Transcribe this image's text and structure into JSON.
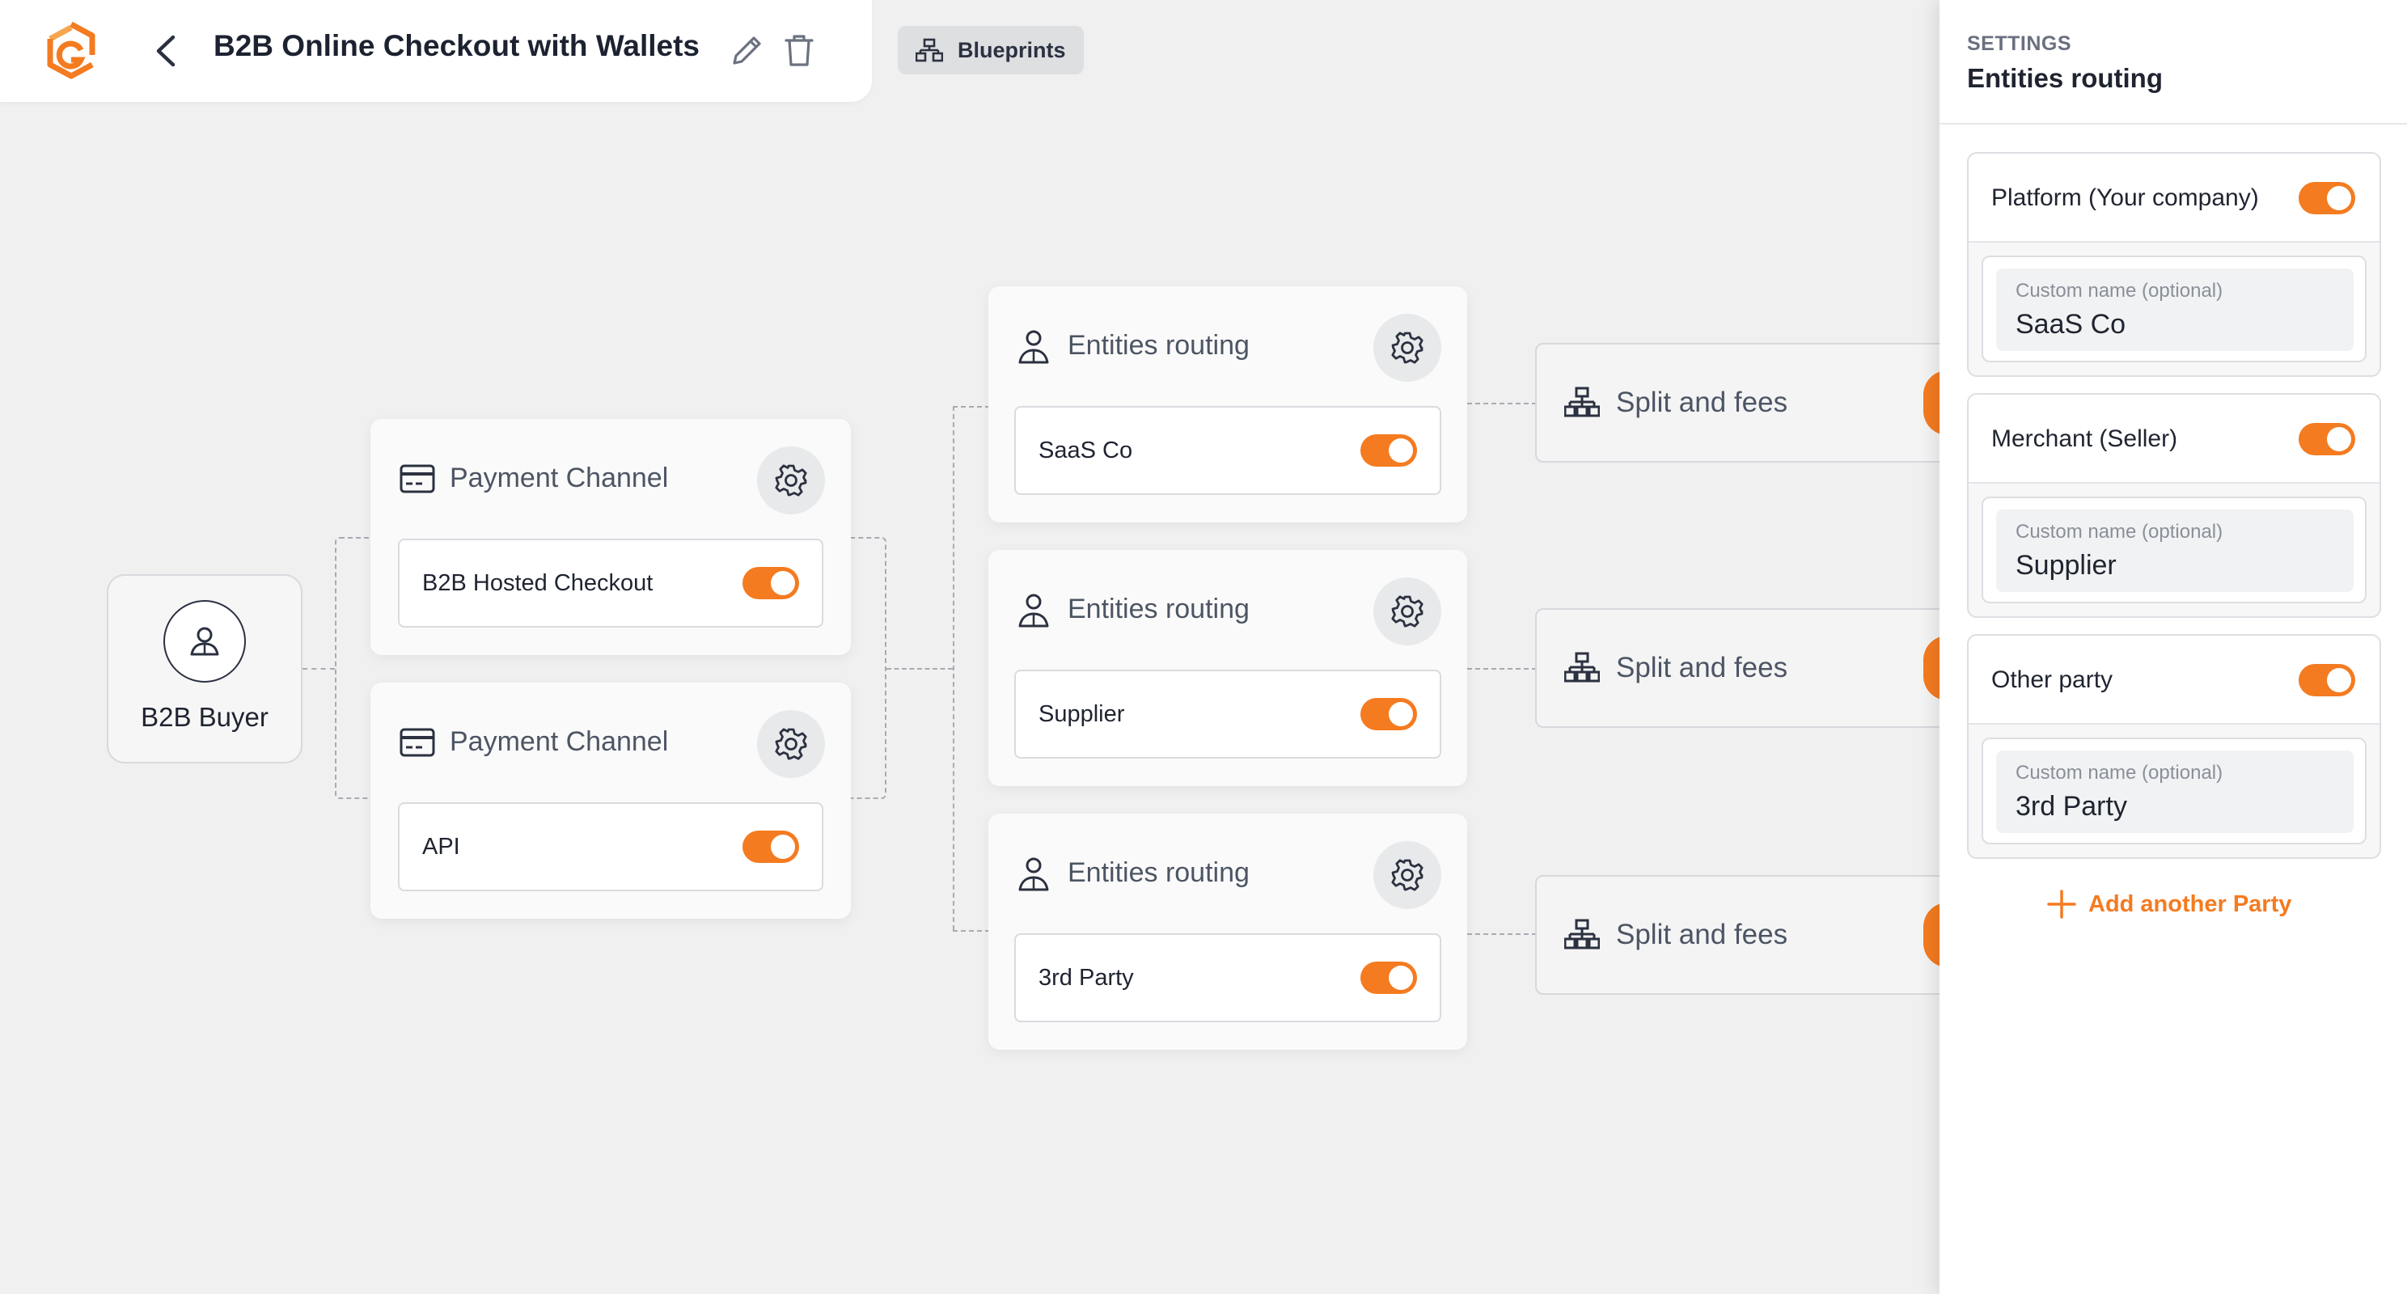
{
  "header": {
    "title": "B2B Online Checkout with Wallets",
    "blueprints_label": "Blueprints"
  },
  "canvas": {
    "buyer": {
      "label": "B2B Buyer"
    },
    "payment_channels": [
      {
        "title": "Payment Channel",
        "item": "B2B Hosted Checkout",
        "enabled": true
      },
      {
        "title": "Payment Channel",
        "item": "API",
        "enabled": true
      }
    ],
    "entities_routing": [
      {
        "title": "Entities routing",
        "item": "SaaS Co",
        "enabled": true
      },
      {
        "title": "Entities routing",
        "item": "Supplier",
        "enabled": true
      },
      {
        "title": "Entities routing",
        "item": "3rd Party",
        "enabled": true
      }
    ],
    "splits": [
      {
        "label": "Split and fees"
      },
      {
        "label": "Split and fees"
      },
      {
        "label": "Split and fees"
      }
    ]
  },
  "settings": {
    "kicker": "SETTINGS",
    "title": "Entities routing",
    "parties": [
      {
        "name": "Platform (Your company)",
        "enabled": true,
        "field_label": "Custom name (optional)",
        "field_value": "SaaS Co"
      },
      {
        "name": "Merchant (Seller)",
        "enabled": true,
        "field_label": "Custom name (optional)",
        "field_value": "Supplier"
      },
      {
        "name": "Other party",
        "enabled": true,
        "field_label": "Custom name (optional)",
        "field_value": "3rd Party"
      }
    ],
    "add_party_label": "Add another Party"
  },
  "colors": {
    "accent": "#f47b20",
    "canvas_bg": "#f0f0f0",
    "card_bg": "#fafafa"
  },
  "icons": {
    "logo": "brand-logo-icon",
    "back": "chevron-left-icon",
    "edit": "pencil-icon",
    "delete": "trash-icon",
    "blueprints": "hierarchy-icon",
    "buyer": "user-icon",
    "payment_channel": "credit-card-icon",
    "entities_routing": "user-icon",
    "settings": "gear-icon",
    "split": "hierarchy-icon",
    "add": "plus-icon"
  }
}
